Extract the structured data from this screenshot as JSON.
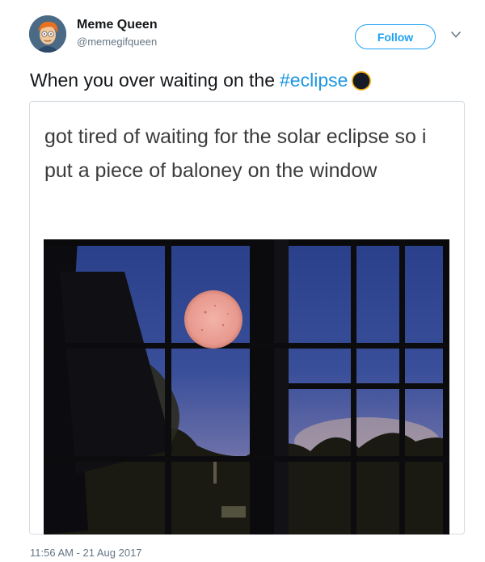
{
  "author": {
    "display_name": "Meme Queen",
    "handle": "@memegifqueen"
  },
  "follow_label": "Follow",
  "tweet": {
    "text": "When you over waiting on the",
    "hashtag": "#eclipse"
  },
  "meme": {
    "caption": "got tired of waiting for the solar eclipse so i put a piece of baloney on the window"
  },
  "timestamp": "11:56 AM - 21 Aug 2017",
  "colors": {
    "accent": "#1da1f2",
    "hashtag": "#1b95e0",
    "muted": "#657786"
  }
}
